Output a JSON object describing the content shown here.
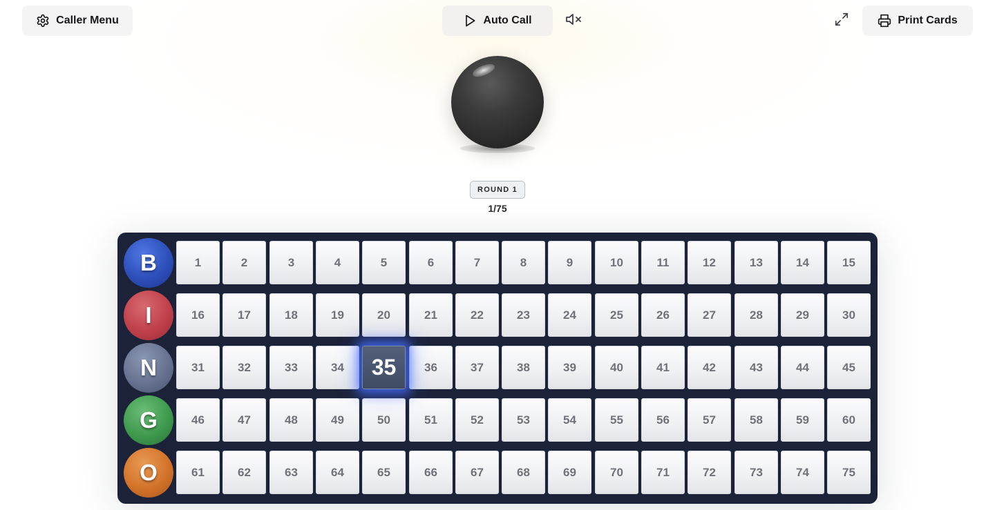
{
  "toolbar": {
    "caller_menu_label": "Caller Menu",
    "auto_call_label": "Auto Call",
    "print_cards_label": "Print Cards",
    "icons": {
      "caller_menu": "gear-icon",
      "auto_call": "play-icon",
      "mute": "volume-muted-icon",
      "fullscreen": "expand-icon",
      "print": "printer-icon"
    }
  },
  "current_ball": {
    "label": "",
    "color": "#2a2a2a"
  },
  "status": {
    "round": "ROUND 1",
    "progress": "1/75"
  },
  "board": {
    "rows": [
      {
        "letter": "B",
        "color": "#2d4fba",
        "numbers": [
          "1",
          "2",
          "3",
          "4",
          "5",
          "6",
          "7",
          "8",
          "9",
          "10",
          "11",
          "12",
          "13",
          "14",
          "15"
        ]
      },
      {
        "letter": "I",
        "color": "#c0404a",
        "numbers": [
          "16",
          "17",
          "18",
          "19",
          "20",
          "21",
          "22",
          "23",
          "24",
          "25",
          "26",
          "27",
          "28",
          "29",
          "30"
        ]
      },
      {
        "letter": "N",
        "color": "#66728f",
        "numbers": [
          "31",
          "32",
          "33",
          "34",
          "35",
          "36",
          "37",
          "38",
          "39",
          "40",
          "41",
          "42",
          "43",
          "44",
          "45"
        ]
      },
      {
        "letter": "G",
        "color": "#3e9a4d",
        "numbers": [
          "46",
          "47",
          "48",
          "49",
          "50",
          "51",
          "52",
          "53",
          "54",
          "55",
          "56",
          "57",
          "58",
          "59",
          "60"
        ]
      },
      {
        "letter": "O",
        "color": "#d3732a",
        "numbers": [
          "61",
          "62",
          "63",
          "64",
          "65",
          "66",
          "67",
          "68",
          "69",
          "70",
          "71",
          "72",
          "73",
          "74",
          "75"
        ]
      }
    ],
    "called_numbers": [
      "35"
    ],
    "board_color": "#1c2238",
    "highlight_color": "#466eff"
  }
}
